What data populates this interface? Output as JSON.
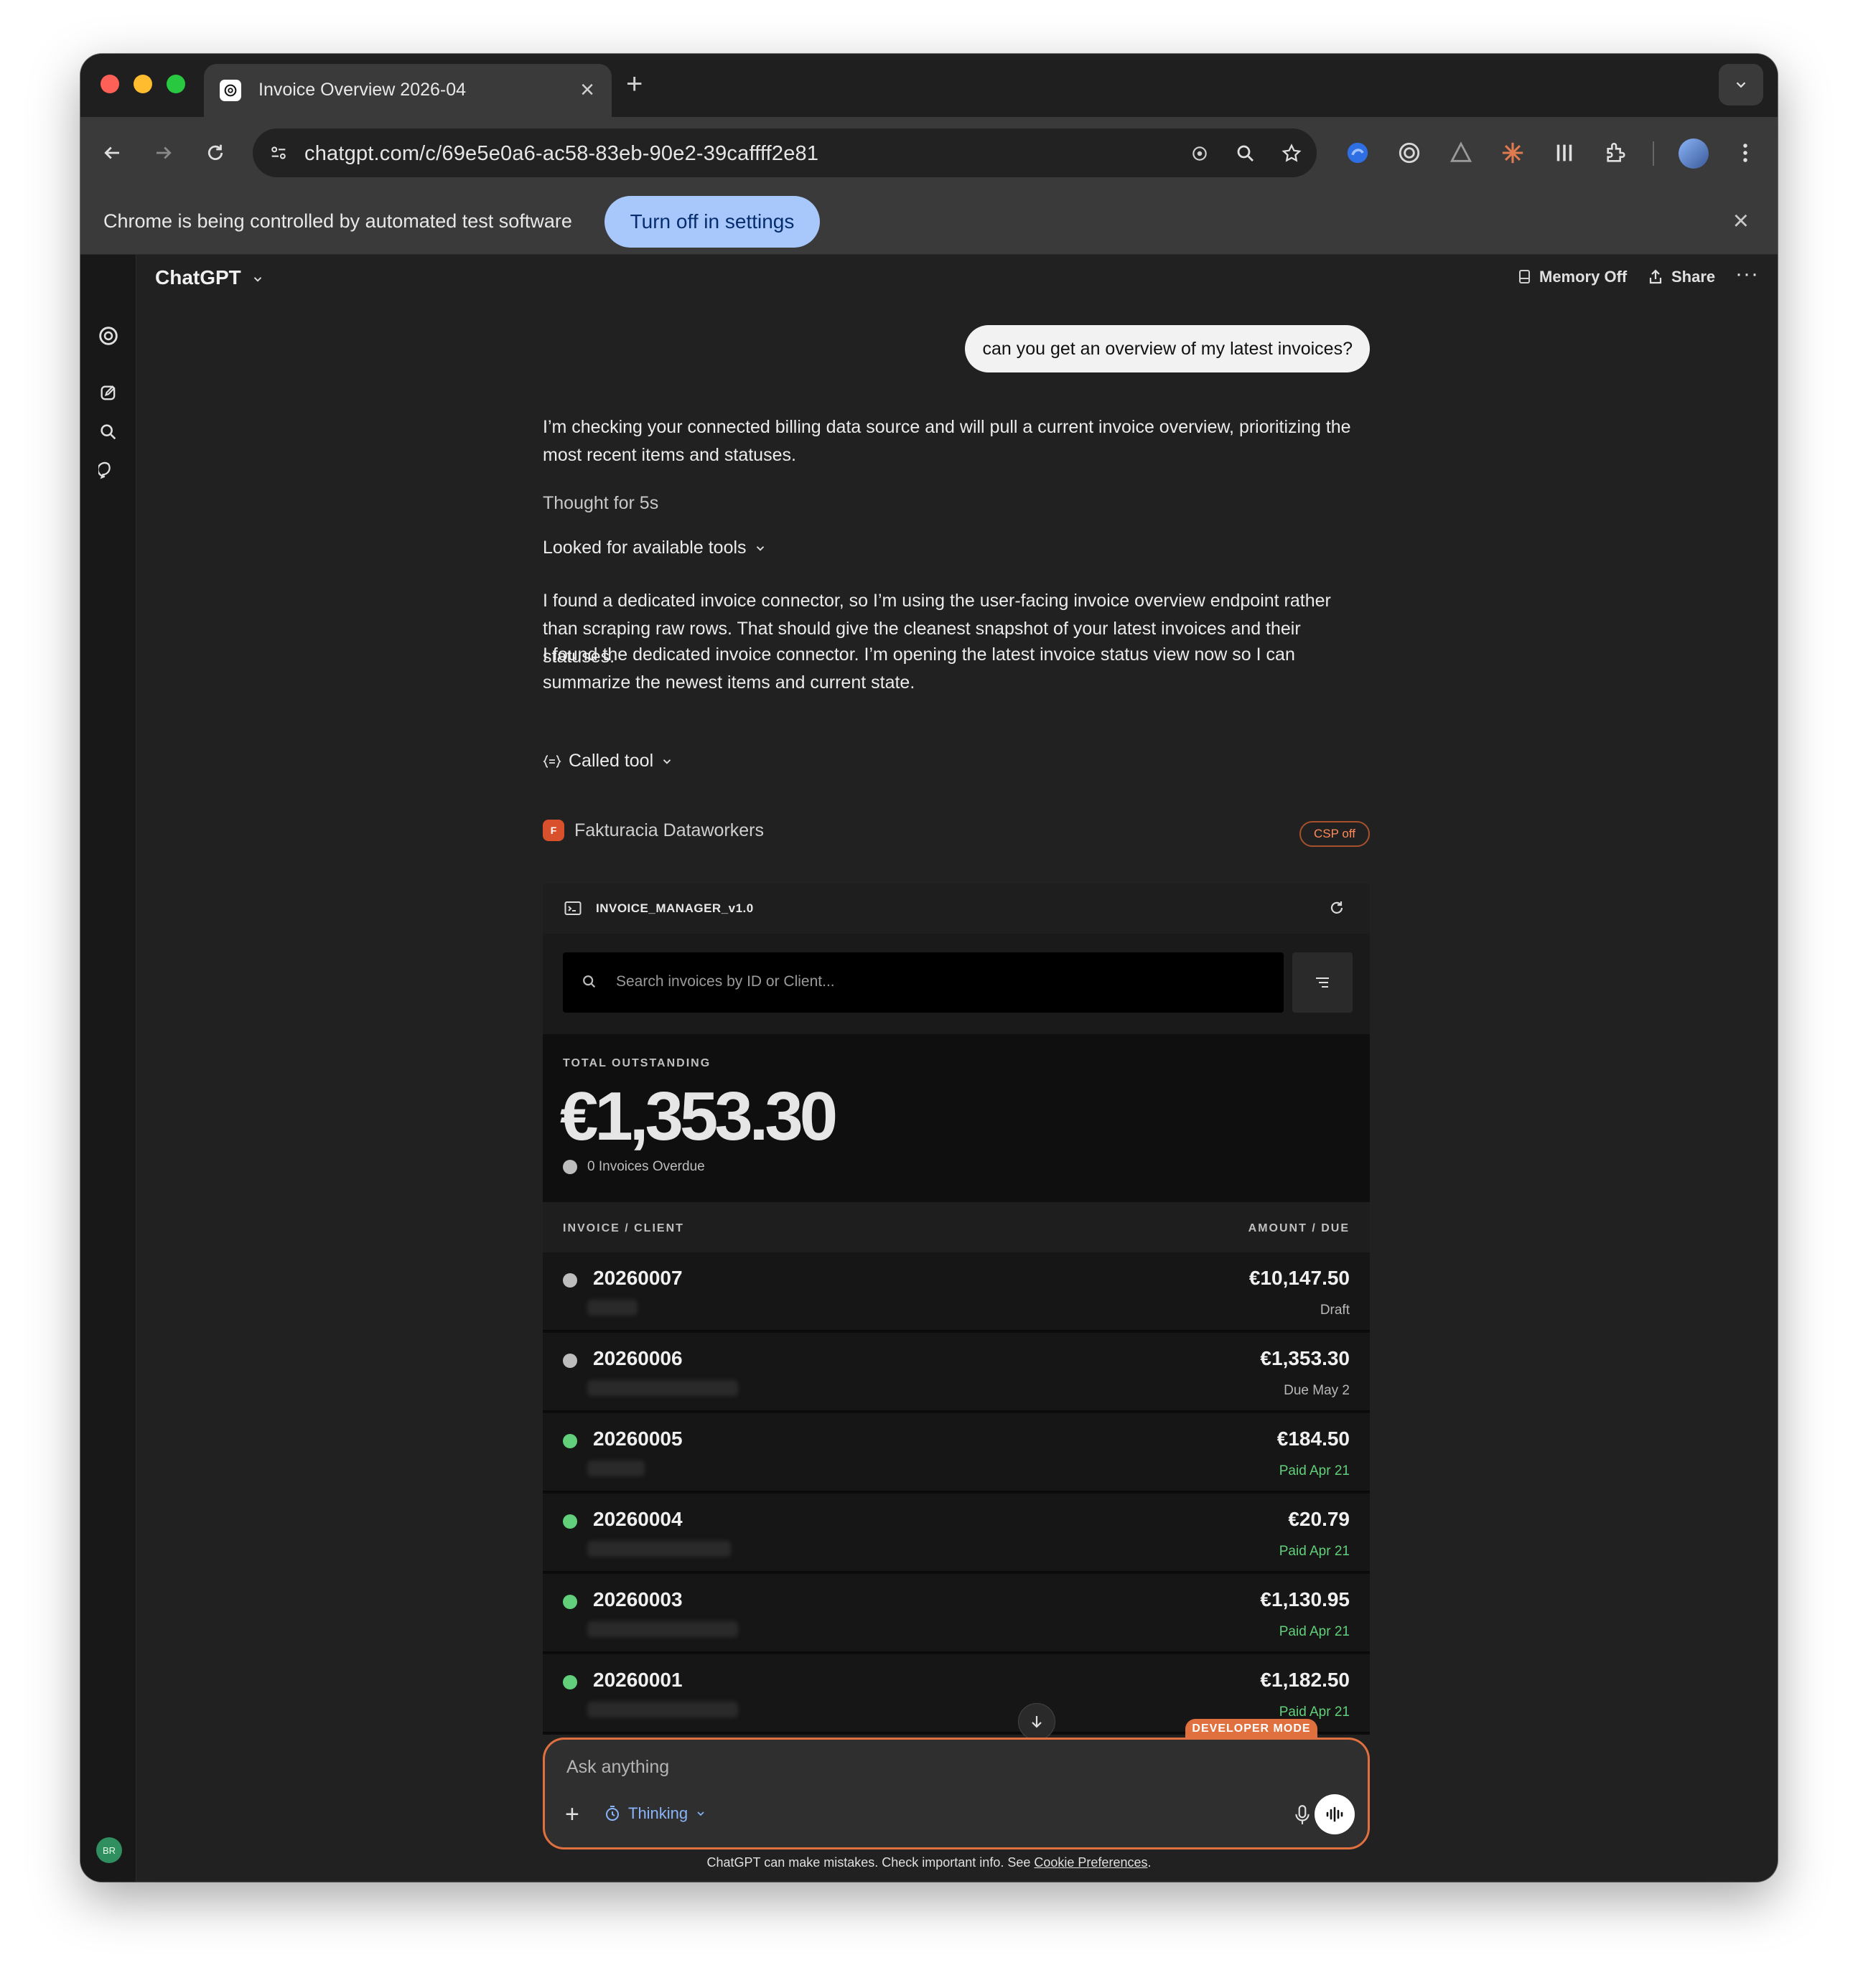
{
  "browser": {
    "tab_title": "Invoice Overview 2026-04",
    "url": "chatgpt.com/c/69e5e0a6-ac58-83eb-90e2-39caffff2e81",
    "infobar_text": "Chrome is being controlled by automated test software",
    "infobar_button": "Turn off in settings"
  },
  "header": {
    "model_name": "ChatGPT",
    "memory_label": "Memory Off",
    "share_label": "Share"
  },
  "sidebar": {
    "avatar_initials": "BR"
  },
  "conversation": {
    "user_message": "can you get an overview of my latest invoices?",
    "assistant_intro": "I’m checking your connected billing data source and will pull a current invoice overview, prioritizing the most recent items and statuses.",
    "thought_label": "Thought for 5s",
    "tools_label": "Looked for available tools",
    "para_connector": "I found a dedicated invoice connector, so I’m using the user-facing invoice overview endpoint rather than scraping raw rows. That should give the cleanest snapshot of your latest invoices and their statuses.",
    "para_opening": "I found the dedicated invoice connector. I’m opening the latest invoice status view now so I can summarize the newest items and current state.",
    "called_tool_label": "Called tool",
    "app_name": "Fakturacia Dataworkers",
    "app_initial": "F",
    "csp_badge": "CSP off"
  },
  "widget": {
    "title": "INVOICE_MANAGER_v1.0",
    "search_placeholder": "Search invoices by ID or Client...",
    "total_label": "TOTAL OUTSTANDING",
    "total_amount": "€1,353.30",
    "overdue_text": "0 Invoices Overdue",
    "col_left": "INVOICE / CLIENT",
    "col_right": "AMOUNT / DUE",
    "invoices": [
      {
        "id": "20260007",
        "amount": "€10,147.50",
        "due": "Draft",
        "status": "draft"
      },
      {
        "id": "20260006",
        "amount": "€1,353.30",
        "due": "Due May 2",
        "status": "open"
      },
      {
        "id": "20260005",
        "amount": "€184.50",
        "due": "Paid Apr 21",
        "status": "paid"
      },
      {
        "id": "20260004",
        "amount": "€20.79",
        "due": "Paid Apr 21",
        "status": "paid"
      },
      {
        "id": "20260003",
        "amount": "€1,130.95",
        "due": "Paid Apr 21",
        "status": "paid"
      },
      {
        "id": "20260001",
        "amount": "€1,182.50",
        "due": "Paid Apr 21",
        "status": "paid"
      }
    ]
  },
  "composer": {
    "developer_badge": "DEVELOPER MODE",
    "placeholder": "Ask anything",
    "thinking_label": "Thinking"
  },
  "footer": {
    "note": "ChatGPT can make mistakes. Check important info. See",
    "link": "Cookie Preferences",
    "end": "."
  },
  "colors": {
    "accent_orange": "#e0713f",
    "paid_green": "#62d07a",
    "infobar_button": "#a8c7fa"
  }
}
